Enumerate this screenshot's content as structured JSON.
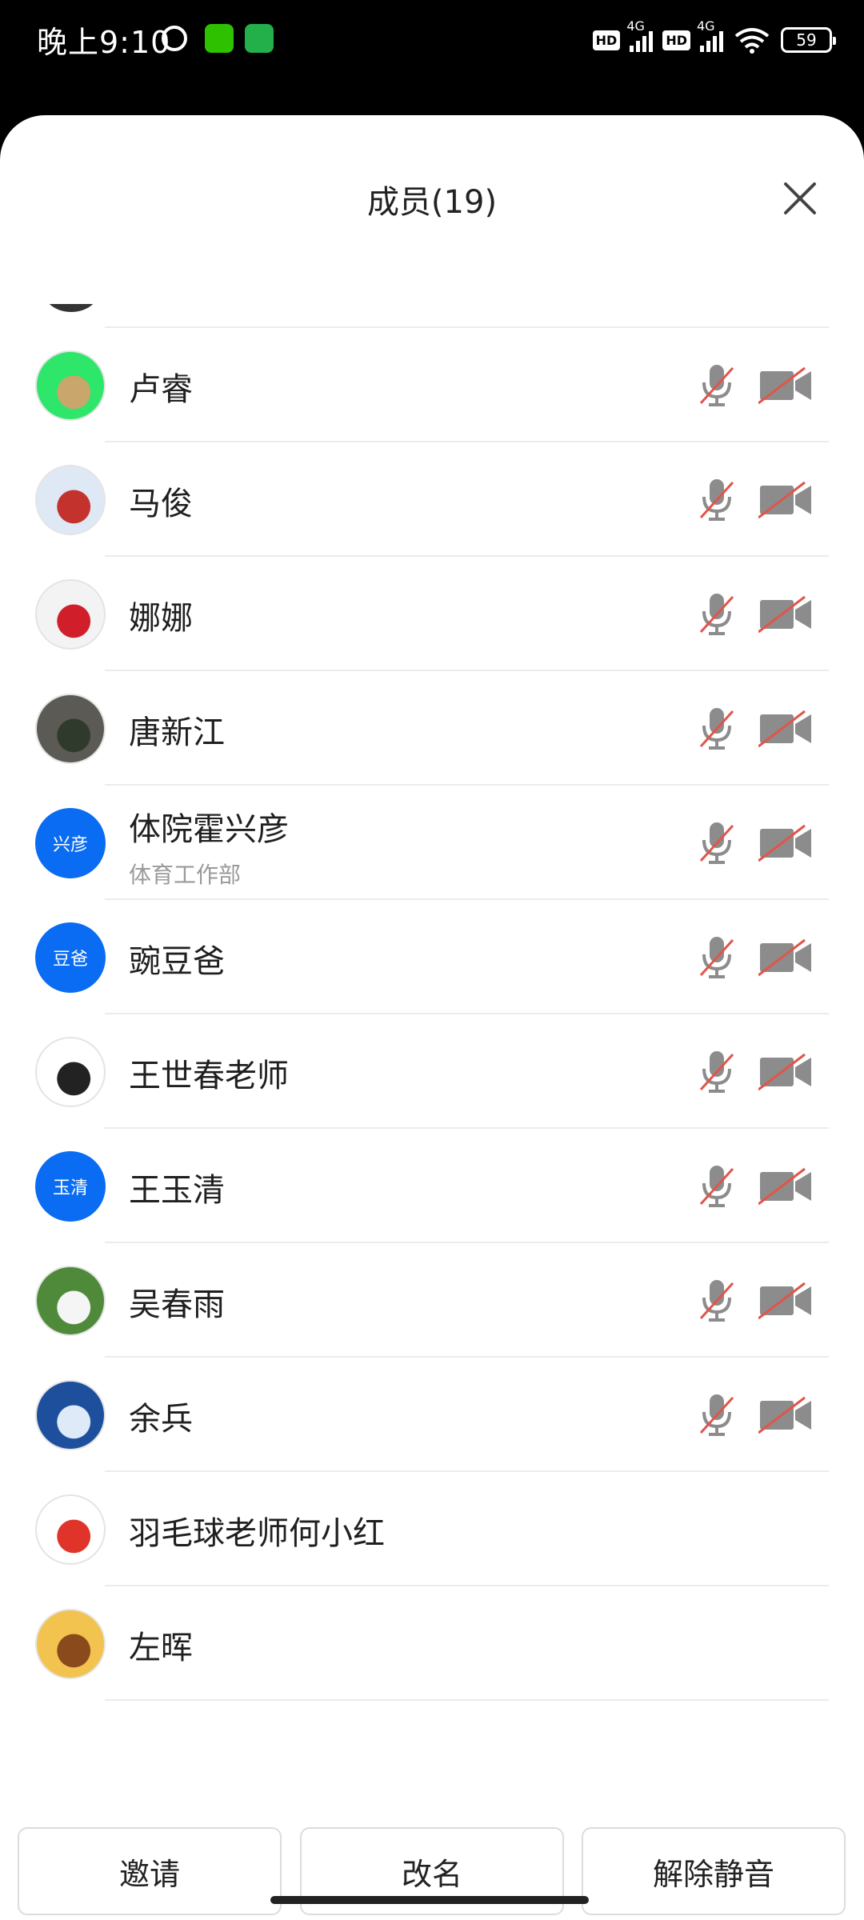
{
  "status_bar": {
    "time": "晚上9:10",
    "battery": "59",
    "network_1": "4G",
    "network_2": "4G",
    "hd_1": "HD",
    "hd_2": "HD"
  },
  "sheet": {
    "title": "成员(19)"
  },
  "members": [
    {
      "name": "卢睿",
      "subtitle": "",
      "avatar_style": "image",
      "avatar_colors": [
        "#2ee66a",
        "#c9a66b"
      ]
    },
    {
      "name": "马俊",
      "subtitle": "",
      "avatar_style": "image",
      "avatar_colors": [
        "#dfe8f5",
        "#c4322d"
      ]
    },
    {
      "name": "娜娜",
      "subtitle": "",
      "avatar_style": "image",
      "avatar_colors": [
        "#f3f3f3",
        "#d01f2a"
      ]
    },
    {
      "name": "唐新江",
      "subtitle": "",
      "avatar_style": "image",
      "avatar_colors": [
        "#5b5a54",
        "#2f3a2c"
      ]
    },
    {
      "name": "体院霍兴彦",
      "subtitle": "体育工作部",
      "avatar_style": "text",
      "avatar_text": "兴彦"
    },
    {
      "name": "豌豆爸",
      "subtitle": "",
      "avatar_style": "text",
      "avatar_text": "豆爸"
    },
    {
      "name": "王世春老师",
      "subtitle": "",
      "avatar_style": "image",
      "avatar_colors": [
        "#ffffff",
        "#222222"
      ]
    },
    {
      "name": "王玉清",
      "subtitle": "",
      "avatar_style": "text",
      "avatar_text": "玉清"
    },
    {
      "name": "吴春雨",
      "subtitle": "",
      "avatar_style": "image",
      "avatar_colors": [
        "#4f8a3a",
        "#f5f5f5"
      ]
    },
    {
      "name": "余兵",
      "subtitle": "",
      "avatar_style": "image",
      "avatar_colors": [
        "#1e4f9d",
        "#dfeaf8"
      ]
    },
    {
      "name": "羽毛球老师何小红",
      "subtitle": "",
      "avatar_style": "image",
      "avatar_colors": [
        "#ffffff",
        "#e0342a"
      ],
      "no_controls": true
    },
    {
      "name": "左晖",
      "subtitle": "",
      "avatar_style": "image",
      "avatar_colors": [
        "#f2c34e",
        "#8a4a1c"
      ],
      "no_controls": true
    }
  ],
  "controls": {
    "mic_icon": "mic-muted-icon",
    "cam_icon": "camera-off-icon",
    "muted_line_color": "#e0554a",
    "icon_color": "#8c8c8c"
  },
  "buttons": {
    "invite": "邀请",
    "rename": "改名",
    "unmute": "解除静音"
  },
  "colors": {
    "accent_blue": "#0a6cf2"
  }
}
